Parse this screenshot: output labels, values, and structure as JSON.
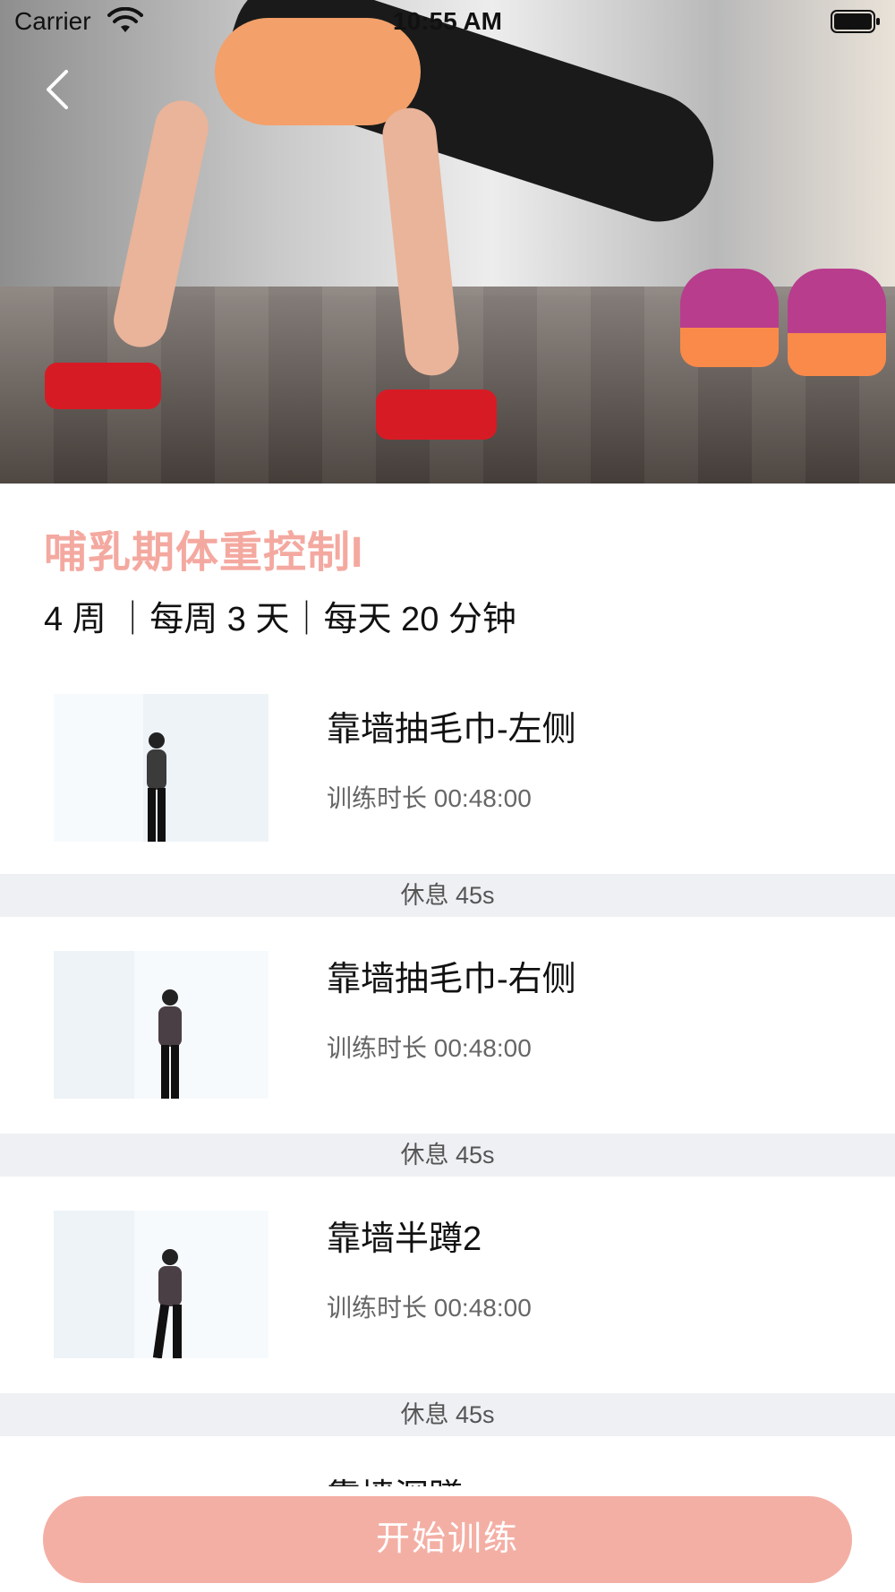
{
  "status_bar": {
    "carrier": "Carrier",
    "time": "10:55 AM"
  },
  "plan": {
    "title": "哺乳期体重控制I",
    "meta": "4 周 ｜每周 3 天｜每天 20 分钟"
  },
  "exercises": [
    {
      "name": "靠墙抽毛巾-左侧",
      "duration": "训练时长 00:48:00"
    },
    {
      "name": "靠墙抽毛巾-右侧",
      "duration": "训练时长 00:48:00"
    },
    {
      "name": "靠墙半蹲2",
      "duration": "训练时长 00:48:00"
    },
    {
      "name": "靠墙深蹲",
      "duration": ""
    }
  ],
  "rests": [
    {
      "label": "休息 45s"
    },
    {
      "label": "休息 45s"
    },
    {
      "label": "休息 45s"
    }
  ],
  "actions": {
    "start_label": "开始训练"
  },
  "colors": {
    "accent": "#f4a9a0",
    "button": "#f4afa5",
    "rest_bg": "#eef0f3"
  },
  "icons": {
    "back": "chevron-left-icon",
    "wifi": "wifi-icon",
    "battery": "battery-icon"
  }
}
